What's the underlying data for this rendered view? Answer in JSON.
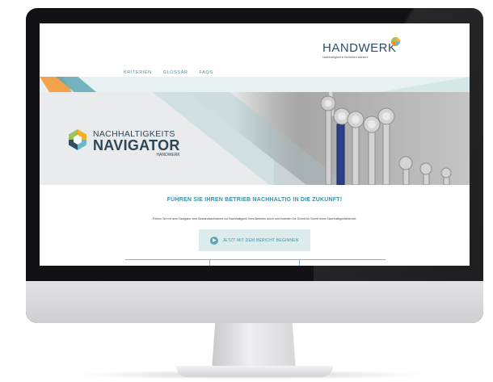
{
  "header": {
    "logo_word": "HANDWERK",
    "logo_tagline": "Nachhaltigkeit in Betrieben stärken!"
  },
  "nav": {
    "items": [
      {
        "label": "KRITERIEN"
      },
      {
        "label": "GLOSSAR"
      },
      {
        "label": "FAQS"
      }
    ]
  },
  "hero": {
    "brand_line1": "NACHHALTIGKEITS",
    "brand_line2": "NAVIGATOR",
    "brand_line3": "HANDWERK"
  },
  "main": {
    "headline": "FÜHREN SIE IHREN BETRIEB NACHHALTIG IN DIE ZUKUNFT!",
    "subline": "Führen Sie mit dem Navigator eine Bestandsaufnahme zur Nachhaltigkeit Ihres Betriebs durch und erstellen Sie Schritt für Schritt einen Nachhaltigkeitsbericht.",
    "cta_label": "JETZT MIT DEM BERICHT BEGINNEN"
  },
  "colors": {
    "accent": "#3f8fa3",
    "brand_dark": "#2b4658",
    "orange": "#f3a24b",
    "cta_bg": "#dcebec"
  },
  "icons": {
    "cta": "play-circle-icon",
    "logo": "handwerk-logo-icon",
    "navigator": "navigator-hexagon-icon"
  }
}
